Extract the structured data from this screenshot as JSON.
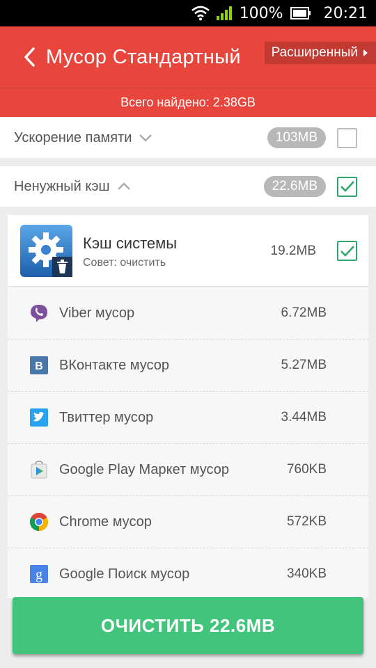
{
  "status_bar": {
    "battery": "100%",
    "time": "20:21"
  },
  "app_bar": {
    "title": "Мусор Стандартный",
    "advanced_button": "Расширенный"
  },
  "summary": "Всего найдено: 2.38GB",
  "memory": {
    "label": "Ускорение памяти",
    "size": "103MB",
    "checked": false
  },
  "cache": {
    "label": "Ненужный кэш",
    "size": "22.6MB",
    "checked": true
  },
  "system_cache": {
    "title": "Кэш системы",
    "subtitle": "Совет: очистить",
    "size": "19.2MB",
    "checked": true
  },
  "junk_items": [
    {
      "name": "Viber мусор",
      "size": "6.72MB",
      "icon": "viber-icon"
    },
    {
      "name": "ВКонтакте мусор",
      "size": "5.27MB",
      "icon": "vk-icon"
    },
    {
      "name": "Твиттер мусор",
      "size": "3.44MB",
      "icon": "twitter-icon"
    },
    {
      "name": "Google Play Маркет мусор",
      "size": "760KB",
      "icon": "google-play-icon"
    },
    {
      "name": "Chrome мусор",
      "size": "572KB",
      "icon": "chrome-icon"
    },
    {
      "name": "Google Поиск мусор",
      "size": "340KB",
      "icon": "google-search-icon"
    }
  ],
  "clean_button": "ОЧИСТИТЬ 22.6MB",
  "colors": {
    "header": "#e8453c",
    "accent_green": "#42c47c",
    "check": "#2ea86b"
  }
}
